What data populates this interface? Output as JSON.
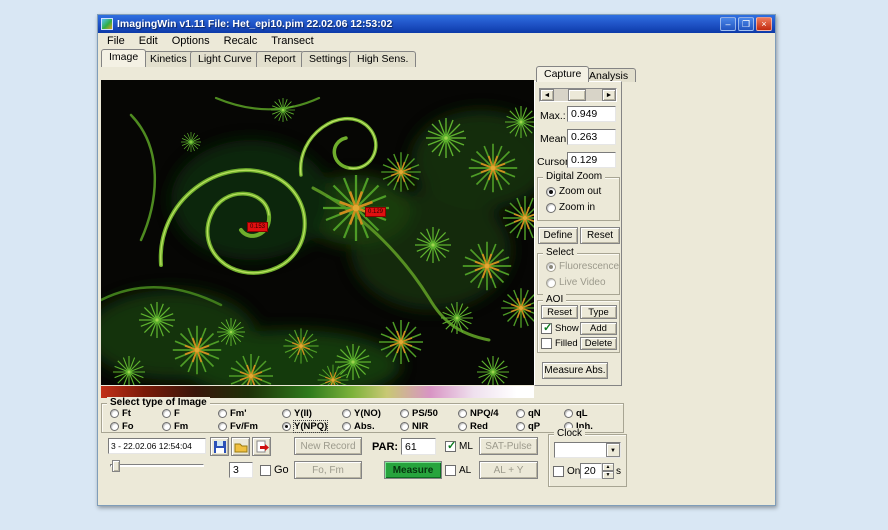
{
  "titlebar": {
    "title": "ImagingWin v1.11   File: Het_epi10.pim  22.02.06 12:53:02",
    "minimize": "–",
    "maximize": "❐",
    "close": "×"
  },
  "menu": {
    "items": [
      "File",
      "Edit",
      "Options",
      "Recalc",
      "Transect"
    ]
  },
  "tabs": {
    "items": [
      "Image",
      "Kinetics",
      "Light Curve",
      "Report",
      "Settings",
      "High Sens."
    ],
    "active": "Image"
  },
  "panel": {
    "tabs": {
      "capture": "Capture",
      "analysis": "Analysis",
      "active": "Capture"
    },
    "scroll": {
      "left": "◄",
      "right": "►"
    },
    "readouts": {
      "max": {
        "label": "Max.:",
        "value": "0.949"
      },
      "mean": {
        "label": "Mean:",
        "value": "0.263"
      },
      "cursor": {
        "label": "Cursor:",
        "value": "0.129"
      }
    },
    "digital_zoom": {
      "title": "Digital Zoom",
      "zoom_out": "Zoom out",
      "zoom_in": "Zoom in",
      "selected": "Zoom out",
      "define": "Define",
      "reset": "Reset"
    },
    "select": {
      "title": "Select",
      "fluorescence": "Fluorescence",
      "live_video": "Live Video",
      "selected": "Fluorescence"
    },
    "aoi": {
      "title": "AOI",
      "reset": "Reset",
      "type": "Type",
      "show": "Show",
      "add": "Add",
      "filled": "Filled",
      "delete": "Delete",
      "show_checked": true,
      "filled_checked": false
    },
    "measure_abs": "Measure Abs."
  },
  "image_area": {
    "aoi_markers": [
      {
        "value": "0.153"
      },
      {
        "value": "0.129"
      }
    ]
  },
  "image_type": {
    "title": "Select type of Image",
    "selected": "Y(NPQ)",
    "row1": [
      "Ft",
      "F",
      "Fm'",
      "Y(II)",
      "Y(NO)",
      "PS/50",
      "NPQ/4",
      "qN",
      "qL"
    ],
    "row2": [
      "Fo",
      "Fm",
      "Fv/Fm",
      "Y(NPQ)",
      "Abs.",
      "NIR",
      "Red",
      "qP",
      "Inh."
    ]
  },
  "controls": {
    "record": {
      "value": "3 - 22.02.06 12:54:04",
      "number": "3",
      "go": "Go"
    },
    "buttons": {
      "new_record": "New Record",
      "fo_fm": "Fo, Fm",
      "measure": "Measure",
      "sat_pulse": "SAT-Pulse",
      "al_y": "AL + Y"
    },
    "par": {
      "label": "PAR:",
      "value": "61"
    },
    "toggles": {
      "ml": "ML",
      "al": "AL",
      "ml_checked": true,
      "al_checked": false
    },
    "clock": {
      "title": "Clock",
      "on": "On",
      "value": "20",
      "unit": "s"
    }
  }
}
